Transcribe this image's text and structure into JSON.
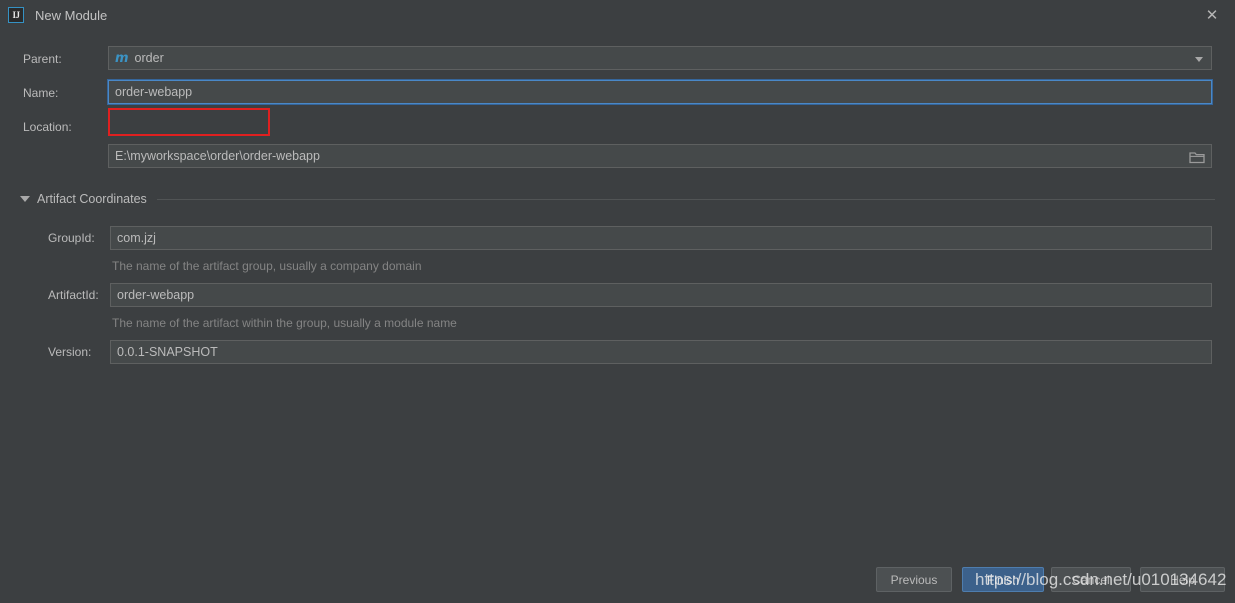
{
  "window": {
    "title": "New Module",
    "app_icon_text": "IJ",
    "close_label": "✕"
  },
  "form": {
    "parent": {
      "label": "Parent:",
      "value": "order",
      "icon": "maven-module-icon",
      "icon_glyph": "m"
    },
    "name": {
      "label": "Name:",
      "value": "order-webapp",
      "focused": true,
      "highlighted": true
    },
    "location": {
      "label": "Location:",
      "value": "E:\\myworkspace\\order\\order-webapp",
      "browse_icon": "folder-icon"
    }
  },
  "artifact_coordinates": {
    "section_title": "Artifact Coordinates",
    "expanded": true,
    "group_id": {
      "label": "GroupId:",
      "value": "com.jzj",
      "hint": "The name of the artifact group, usually a company domain"
    },
    "artifact_id": {
      "label": "ArtifactId:",
      "value": "order-webapp",
      "hint": "The name of the artifact within the group, usually a module name"
    },
    "version": {
      "label": "Version:",
      "value": "0.0.1-SNAPSHOT"
    }
  },
  "footer": {
    "previous": "Previous",
    "finish": "Finish",
    "cancel": "Cancel",
    "help": "Help"
  },
  "watermark": {
    "text": "https://blog.csdn.net/u010134642"
  },
  "colors": {
    "background": "#3c3f41",
    "field_background": "#45494a",
    "field_border": "#5e6060",
    "focus_border": "#4a88c7",
    "primary_button": "#3c618b",
    "annotation_red": "#e02020",
    "maven_icon": "#3b93c4",
    "text": "#bbbbbb",
    "hint_text": "#848484"
  }
}
